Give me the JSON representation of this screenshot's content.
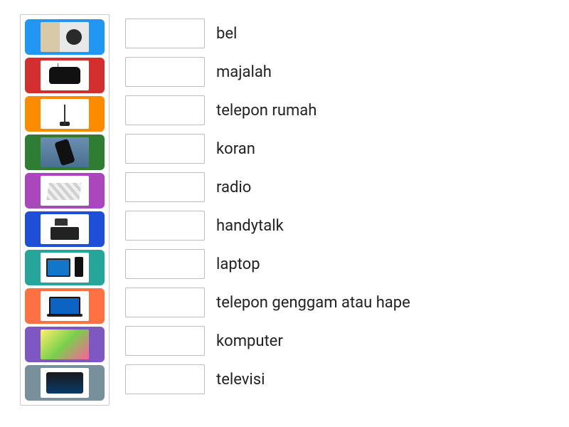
{
  "cards": [
    {
      "name": "card-bell",
      "color": "#2196f3",
      "thumb": "t-bell"
    },
    {
      "name": "card-radio",
      "color": "#d32f2f",
      "thumb": "t-radio"
    },
    {
      "name": "card-handytalk",
      "color": "#fb8c00",
      "thumb": "t-antenna"
    },
    {
      "name": "card-handphone",
      "color": "#2e7d32",
      "thumb": "t-phone"
    },
    {
      "name": "card-newspaper",
      "color": "#ab47bc",
      "thumb": "t-papers"
    },
    {
      "name": "card-deskphone",
      "color": "#1e4fd6",
      "thumb": "t-desk"
    },
    {
      "name": "card-computer",
      "color": "#26a69a",
      "thumb": "t-pc"
    },
    {
      "name": "card-laptop",
      "color": "#ff7043",
      "thumb": "t-laptop"
    },
    {
      "name": "card-magazine",
      "color": "#7e57c2",
      "thumb": "t-mag"
    },
    {
      "name": "card-television",
      "color": "#78909c",
      "thumb": "t-tv"
    }
  ],
  "answers": [
    {
      "label": "bel"
    },
    {
      "label": "majalah"
    },
    {
      "label": "telepon rumah"
    },
    {
      "label": "koran"
    },
    {
      "label": "radio"
    },
    {
      "label": "handytalk"
    },
    {
      "label": "laptop"
    },
    {
      "label": "telepon genggam atau hape"
    },
    {
      "label": "komputer"
    },
    {
      "label": "televisi"
    }
  ]
}
